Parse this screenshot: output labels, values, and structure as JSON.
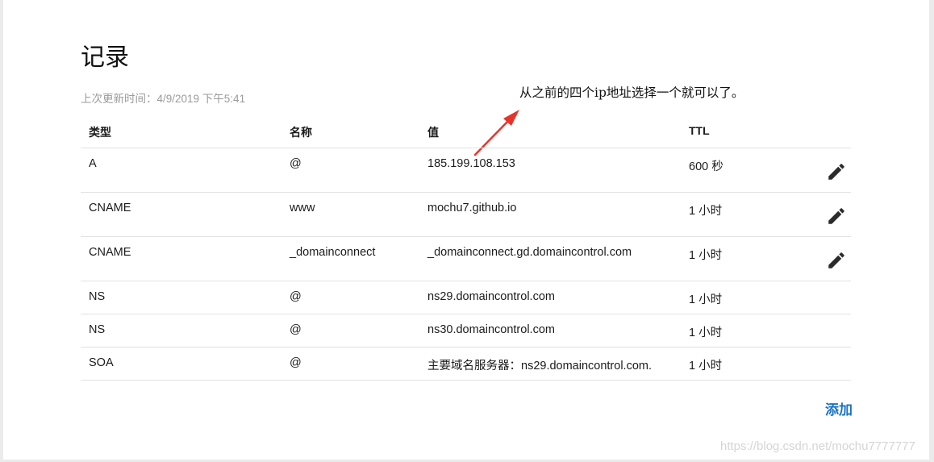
{
  "page": {
    "title": "记录",
    "last_updated": "上次更新时间：4/9/2019 下午5:41",
    "annotation": "从之前的四个ip地址选择一个就可以了。",
    "watermark": "https://blog.csdn.net/mochu7777777"
  },
  "table": {
    "headers": {
      "type": "类型",
      "name": "名称",
      "value": "值",
      "ttl": "TTL"
    },
    "rows": [
      {
        "type": "A",
        "name": "@",
        "value": "185.199.108.153",
        "ttl": "600 秒",
        "editable": true
      },
      {
        "type": "CNAME",
        "name": "www",
        "value": "mochu7.github.io",
        "ttl": "1 小时",
        "editable": true
      },
      {
        "type": "CNAME",
        "name": "_domainconnect",
        "value": "_domainconnect.gd.domaincontrol.com",
        "ttl": "1 小时",
        "editable": true
      },
      {
        "type": "NS",
        "name": "@",
        "value": "ns29.domaincontrol.com",
        "ttl": "1 小时",
        "editable": false
      },
      {
        "type": "NS",
        "name": "@",
        "value": "ns30.domaincontrol.com",
        "ttl": "1 小时",
        "editable": false
      },
      {
        "type": "SOA",
        "name": "@",
        "value": "主要域名服务器：ns29.domaincontrol.com.",
        "ttl": "1 小时",
        "editable": false
      }
    ]
  },
  "actions": {
    "add_label": "添加"
  },
  "icons": {
    "edit": "pencil-icon"
  },
  "colors": {
    "link": "#1a73c6",
    "arrow": "#e8332b",
    "edit_icon": "#2b2b2b"
  }
}
